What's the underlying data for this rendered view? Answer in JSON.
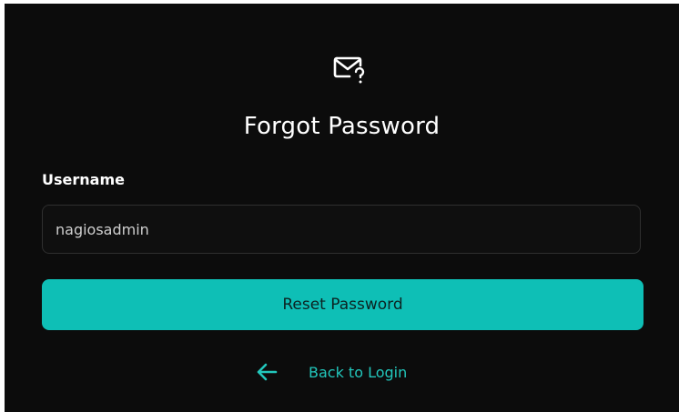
{
  "header": {
    "icon": "mail-question-icon",
    "title": "Forgot Password"
  },
  "form": {
    "username_label": "Username",
    "username_value": "nagiosadmin",
    "reset_button_label": "Reset Password"
  },
  "footer": {
    "back_icon": "arrow-left-icon",
    "back_link_label": "Back to Login"
  },
  "colors": {
    "background": "#0c0c0c",
    "accent": "#0ebfb6",
    "link": "#22c7bc"
  }
}
